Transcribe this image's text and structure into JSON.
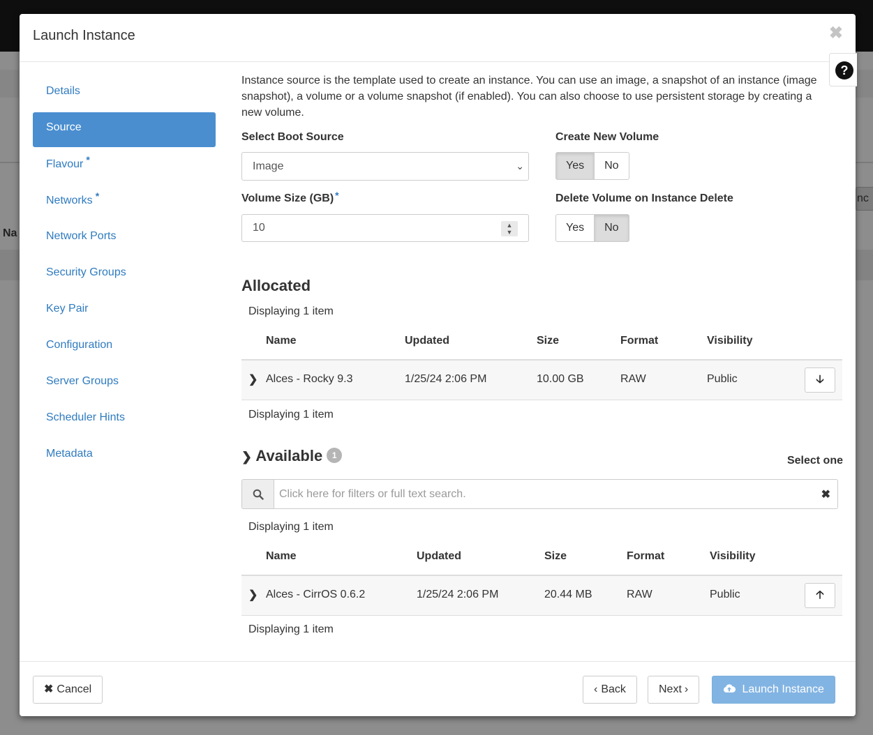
{
  "modal": {
    "title": "Launch Instance",
    "close_icon": "✖",
    "help_icon": "?"
  },
  "nav": {
    "items": [
      {
        "label": "Details",
        "required": false,
        "active": false
      },
      {
        "label": "Source",
        "required": false,
        "active": true
      },
      {
        "label": "Flavour",
        "required": true,
        "active": false
      },
      {
        "label": "Networks",
        "required": true,
        "active": false
      },
      {
        "label": "Network Ports",
        "required": false,
        "active": false
      },
      {
        "label": "Security Groups",
        "required": false,
        "active": false
      },
      {
        "label": "Key Pair",
        "required": false,
        "active": false
      },
      {
        "label": "Configuration",
        "required": false,
        "active": false
      },
      {
        "label": "Server Groups",
        "required": false,
        "active": false
      },
      {
        "label": "Scheduler Hints",
        "required": false,
        "active": false
      },
      {
        "label": "Metadata",
        "required": false,
        "active": false
      }
    ],
    "required_marker": "*"
  },
  "source": {
    "intro": "Instance source is the template used to create an instance. You can use an image, a snapshot of an instance (image snapshot), a volume or a volume snapshot (if enabled). You can also choose to use persistent storage by creating a new volume.",
    "boot_source_label": "Select Boot Source",
    "boot_source_value": "Image",
    "create_volume_label": "Create New Volume",
    "create_volume_yes": "Yes",
    "create_volume_no": "No",
    "create_volume_selected": "Yes",
    "volume_size_label": "Volume Size (GB)",
    "volume_size_value": "10",
    "delete_volume_label": "Delete Volume on Instance Delete",
    "delete_volume_yes": "Yes",
    "delete_volume_no": "No",
    "delete_volume_selected": "No"
  },
  "allocated": {
    "title": "Allocated",
    "count_text": "Displaying 1 item",
    "columns": [
      "Name",
      "Updated",
      "Size",
      "Format",
      "Visibility"
    ],
    "rows": [
      {
        "name": "Alces - Rocky 9.3",
        "updated": "1/25/24 2:06 PM",
        "size": "10.00 GB",
        "format": "RAW",
        "visibility": "Public"
      }
    ],
    "row_action_icon": "arrow-down-icon"
  },
  "available": {
    "title": "Available",
    "badge": "1",
    "select_hint": "Select one",
    "search_placeholder": "Click here for filters or full text search.",
    "count_text": "Displaying 1 item",
    "columns": [
      "Name",
      "Updated",
      "Size",
      "Format",
      "Visibility"
    ],
    "rows": [
      {
        "name": "Alces - CirrOS 0.6.2",
        "updated": "1/25/24 2:06 PM",
        "size": "20.44 MB",
        "format": "RAW",
        "visibility": "Public"
      }
    ],
    "row_action_icon": "arrow-up-icon"
  },
  "footer": {
    "cancel": "Cancel",
    "back": "Back",
    "next": "Next",
    "launch": "Launch Instance"
  },
  "background": {
    "partial_column": "Na",
    "partial_button": "nc"
  },
  "colors": {
    "accent": "#4a8ed0",
    "link": "#2f7bbf",
    "primary_disabled": "#82b4e3"
  }
}
